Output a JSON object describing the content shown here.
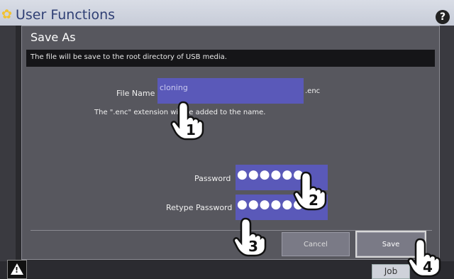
{
  "background": {
    "title": "User Functions",
    "help_label": "?",
    "job_label": "Job"
  },
  "dialog": {
    "title": "Save As",
    "info": "The file will be save to the root directory of USB media.",
    "file_name_label": "File Name",
    "file_name_value": "cloning",
    "extension": ".enc",
    "note": "The \".enc\" extension will be added to the name.",
    "password_label": "Password",
    "password_value": "●●●●●●",
    "retype_label": "Retype Password",
    "retype_value": "●●●●●●",
    "cancel_label": "Cancel",
    "save_label": "Save"
  },
  "callouts": {
    "step1": "1",
    "step2": "2",
    "step3": "3",
    "step4": "4"
  },
  "colors": {
    "field": "#5a59b9",
    "dialog": "#57575e",
    "info_bar": "#151518"
  }
}
